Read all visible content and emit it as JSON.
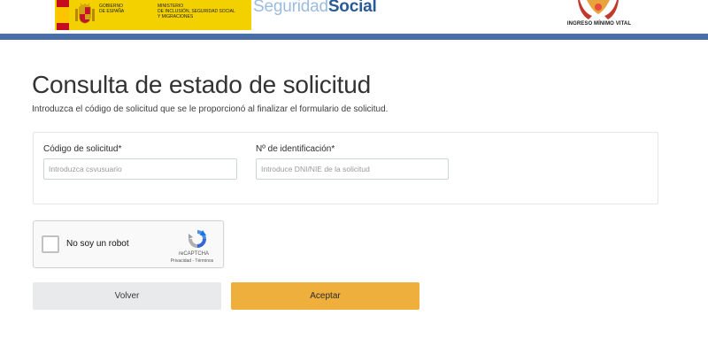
{
  "header": {
    "gobierno_lines": [
      "GOBIERNO",
      "DE ESPAÑA"
    ],
    "ministerio_lines": [
      "MINISTERIO",
      "DE INCLUSIÓN, SEGURIDAD SOCIAL",
      "Y MIGRACIONES"
    ],
    "ss_logo_part1": "Seguridad",
    "ss_logo_part2": "Social",
    "imv_label": "INGRESO MÍNIMO VITAL"
  },
  "page": {
    "title": "Consulta de estado de solicitud",
    "subtitle": "Introduzca el código de solicitud que se le proporcionó al finalizar el formulario de solicitud."
  },
  "form": {
    "code_label": "Código de solicitud*",
    "code_placeholder": "Introduzca csvusuario",
    "code_value": "",
    "id_label": "Nº de identificación*",
    "id_placeholder": "Introduce DNI/NIE de la solicitud",
    "id_value": ""
  },
  "recaptcha": {
    "label": "No soy un robot",
    "brand": "reCAPTCHA",
    "links": "Privacidad - Términos",
    "checked": false,
    "icon": "recaptcha-logo-icon"
  },
  "buttons": {
    "back_label": "Volver",
    "accept_label": "Aceptar"
  },
  "colors": {
    "header_rule": "#4a6fa8",
    "gobierno_yellow": "#f3d100",
    "accept_button": "#eeaf3c",
    "back_button": "#e9eaeb",
    "seguridad_social_blue": "#2b5a99"
  }
}
